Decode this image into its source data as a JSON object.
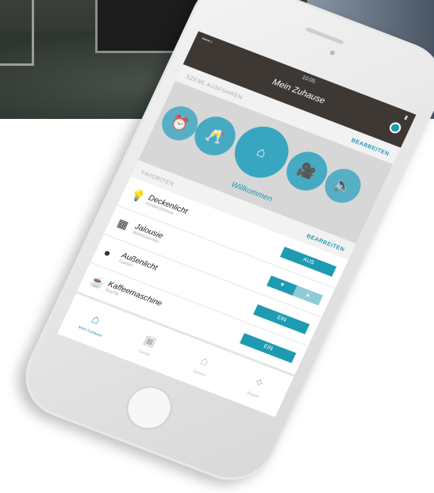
{
  "status": {
    "carrier": "••••○",
    "time": "10:05",
    "battery": "▮"
  },
  "header": {
    "title": "Mein Zuhause"
  },
  "scenes_section": {
    "label": "SZENE AUSFÜHREN",
    "edit": "BEARBEITEN",
    "active_scene": "Willkommen"
  },
  "favorites_section": {
    "label": "FAVORITEN",
    "edit": "BEARBEITEN"
  },
  "favorites": [
    {
      "name": "Deckenlicht",
      "room": "Kinderzimmer",
      "button": "AUS"
    },
    {
      "name": "Jalousie",
      "room": "Wohnzimmer",
      "button_left": "▼",
      "button_right": "▲"
    },
    {
      "name": "Außenlicht",
      "room": "Garten",
      "button": "EIN"
    },
    {
      "name": "Kaffeemaschine",
      "room": "Küche",
      "button": "EIN"
    }
  ],
  "tabs": [
    {
      "label": "Mein Zuhause",
      "icon": "house-icon"
    },
    {
      "label": "Geräte",
      "icon": "devices-icon"
    },
    {
      "label": "Szenen",
      "icon": "scenes-icon"
    },
    {
      "label": "Regeln",
      "icon": "rules-icon"
    }
  ],
  "colors": {
    "accent": "#1e9bb2",
    "header": "#3d3833"
  }
}
